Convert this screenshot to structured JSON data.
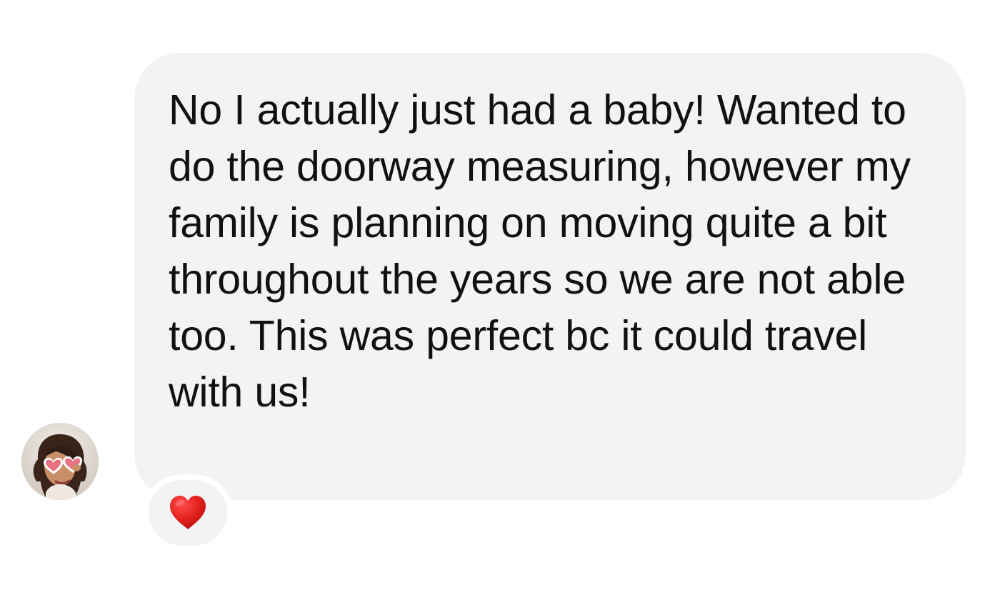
{
  "message": {
    "text": "No I actually just had a baby! Wanted to do the doorway measuring, however my family is planning on moving quite a bit throughout the years so we are not able too. This was perfect bc it could travel with us!",
    "bubble_color": "#f2f3f5",
    "text_color": "#111111"
  },
  "sender": {
    "avatar_icon": "profile-photo"
  },
  "reaction": {
    "icon": "red-heart-icon",
    "color": "#e0201b"
  }
}
